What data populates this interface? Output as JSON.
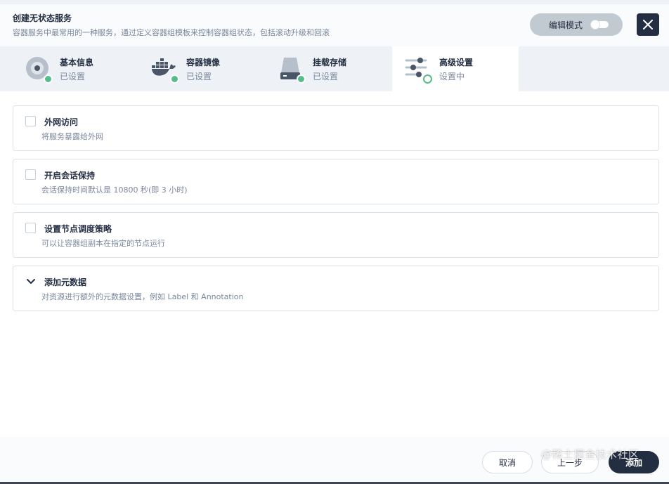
{
  "header": {
    "title": "创建无状态服务",
    "description": "容器服务中最常用的一种服务，通过定义容器组模板来控制容器组状态，包括滚动升级和回滚",
    "edit_mode_label": "编辑模式"
  },
  "steps": [
    {
      "title": "基本信息",
      "status": "已设置",
      "icon": "disc-icon"
    },
    {
      "title": "容器镜像",
      "status": "已设置",
      "icon": "docker-whale-icon"
    },
    {
      "title": "挂载存储",
      "status": "已设置",
      "icon": "hard-drive-icon"
    },
    {
      "title": "高级设置",
      "status": "设置中",
      "icon": "sliders-icon"
    }
  ],
  "options": [
    {
      "title": "外网访问",
      "description": "将服务暴露给外网"
    },
    {
      "title": "开启会话保持",
      "description": "会话保持时间默认是 10800 秒(即 3 小时)"
    },
    {
      "title": "设置节点调度策略",
      "description": "可以让容器组副本在指定的节点运行"
    }
  ],
  "metadata_section": {
    "title": "添加元数据",
    "description": "对资源进行额外的元数据设置，例如 Label 和 Annotation"
  },
  "footer": {
    "cancel_label": "取消",
    "prev_label": "上一步",
    "add_label": "添加"
  },
  "watermark": "@稀土掘金技术社区",
  "colors": {
    "primary_dark": "#242e42",
    "success": "#55bc8a",
    "muted_text": "#79879c",
    "border": "#dde3eb"
  }
}
